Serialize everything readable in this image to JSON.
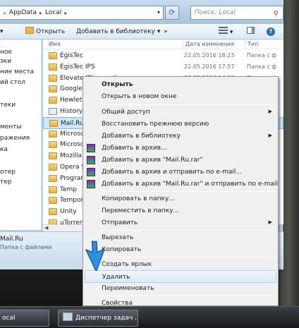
{
  "address": {
    "crumbs": [
      "AppData",
      "Local"
    ],
    "chevron": "«",
    "search_placeholder": "Поиск: Local"
  },
  "toolbar": {
    "open_label": "Открыть",
    "add_to_library_label": "Добавить в библиотеку",
    "more_label": "»"
  },
  "navpane": {
    "items": [
      "ное",
      "зки",
      "ние места",
      "ий стол",
      "теки",
      "менты",
      "ражения",
      "ка",
      "отер",
      "тер"
    ]
  },
  "columns": {
    "name": "Имя",
    "date": "Дата изменения",
    "type": "Тип"
  },
  "files": [
    {
      "name": "EgisTec",
      "date": "22.05.2016 18:23",
      "type": "Папка с ф",
      "icon": "folder"
    },
    {
      "name": "EgisTec IPS",
      "date": "22.05.2016 17:57",
      "type": "Папка с ф",
      "icon": "folder"
    },
    {
      "name": "ElevatedDiagnostics",
      "date": "03.05.2016 14:27",
      "type": "Папка с ф",
      "icon": "folder"
    },
    {
      "name": "Google",
      "date": "",
      "type": "",
      "icon": "folder"
    },
    {
      "name": "Hewlett-",
      "date": "",
      "type": "",
      "icon": "folder"
    },
    {
      "name": "History",
      "date": "",
      "type": "",
      "icon": "history"
    },
    {
      "name": "Mail.Ru",
      "date": "",
      "type": "",
      "icon": "folder"
    },
    {
      "name": "Microso",
      "date": "",
      "type": "",
      "icon": "folder"
    },
    {
      "name": "Microso",
      "date": "",
      "type": "",
      "icon": "folder"
    },
    {
      "name": "Mozilla",
      "date": "",
      "type": "",
      "icon": "folder"
    },
    {
      "name": "Opera S",
      "date": "",
      "type": "",
      "icon": "folder"
    },
    {
      "name": "Program",
      "date": "",
      "type": "",
      "icon": "folder"
    },
    {
      "name": "Temp",
      "date": "",
      "type": "",
      "icon": "folder"
    },
    {
      "name": "Tempor",
      "date": "",
      "type": "",
      "icon": "folder"
    },
    {
      "name": "Unity",
      "date": "",
      "type": "",
      "icon": "folder"
    },
    {
      "name": "uTorrent",
      "date": "",
      "type": "",
      "icon": "folder"
    }
  ],
  "details": {
    "name": "Mail.Ru",
    "type": "Папка с файлами"
  },
  "context_menu": {
    "open": "Открыть",
    "open_new_window": "Открыть в новом окне",
    "share": "Общий доступ",
    "restore_prev": "Восстановить прежнюю версию",
    "add_to_library": "Добавить в библиотеку",
    "add_to_archive": "Добавить в архив...",
    "add_to_rar": "Добавить в архив \"Mail.Ru.rar\"",
    "archive_email": "Добавить в архив и отправить по e-mail...",
    "rar_email": "Добавить в архив \"Mail.Ru.rar\" и отправить по e-mail",
    "copy_to": "Копировать в папку...",
    "move_to": "Переместить в папку...",
    "send_to": "Отправить",
    "cut": "Вырезать",
    "copy": "Копировать",
    "create_shortcut": "Создать ярлык",
    "delete": "Удалить",
    "rename": "Переименовать",
    "properties": "Свойства"
  },
  "taskbar": {
    "explorer_label": "ocal",
    "task_manager_label": "Диспетчер задач ..."
  },
  "colors": {
    "selection": "#cce6fb",
    "menu_hover": "#dde9f7",
    "cursor": "#2f8fe0"
  }
}
